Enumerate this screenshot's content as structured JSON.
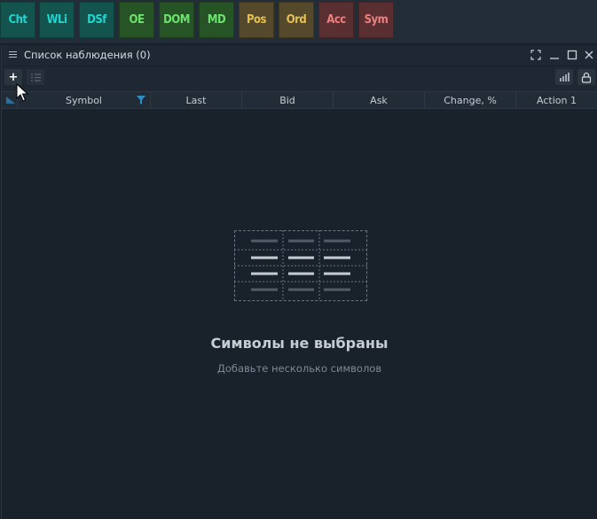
{
  "toolbar": {
    "buttons": [
      {
        "label": "Cht",
        "bg": "#13544f",
        "fg": "#1fd6cf"
      },
      {
        "label": "WLi",
        "bg": "#13544f",
        "fg": "#1fd6cf"
      },
      {
        "label": "DSf",
        "bg": "#13544f",
        "fg": "#1fd6cf"
      },
      {
        "label": "OE",
        "bg": "#275427",
        "fg": "#6ee26e"
      },
      {
        "label": "DOM",
        "bg": "#275427",
        "fg": "#6ee26e"
      },
      {
        "label": "MD",
        "bg": "#275427",
        "fg": "#6ee26e"
      },
      {
        "label": "Pos",
        "bg": "#54492a",
        "fg": "#e7c052"
      },
      {
        "label": "Ord",
        "bg": "#54492a",
        "fg": "#e7c052"
      },
      {
        "label": "Acc",
        "bg": "#5a2f31",
        "fg": "#ee7f7f"
      },
      {
        "label": "Sym",
        "bg": "#5a2f31",
        "fg": "#ee7f7f"
      }
    ]
  },
  "panel": {
    "title": "Список наблюдения (0)",
    "add_label": "+",
    "columns": [
      "Symbol",
      "Last",
      "Bid",
      "Ask",
      "Change, %",
      "Action 1"
    ]
  },
  "empty_state": {
    "title": "Символы не выбраны",
    "subtitle": "Добавьте несколько символов"
  }
}
